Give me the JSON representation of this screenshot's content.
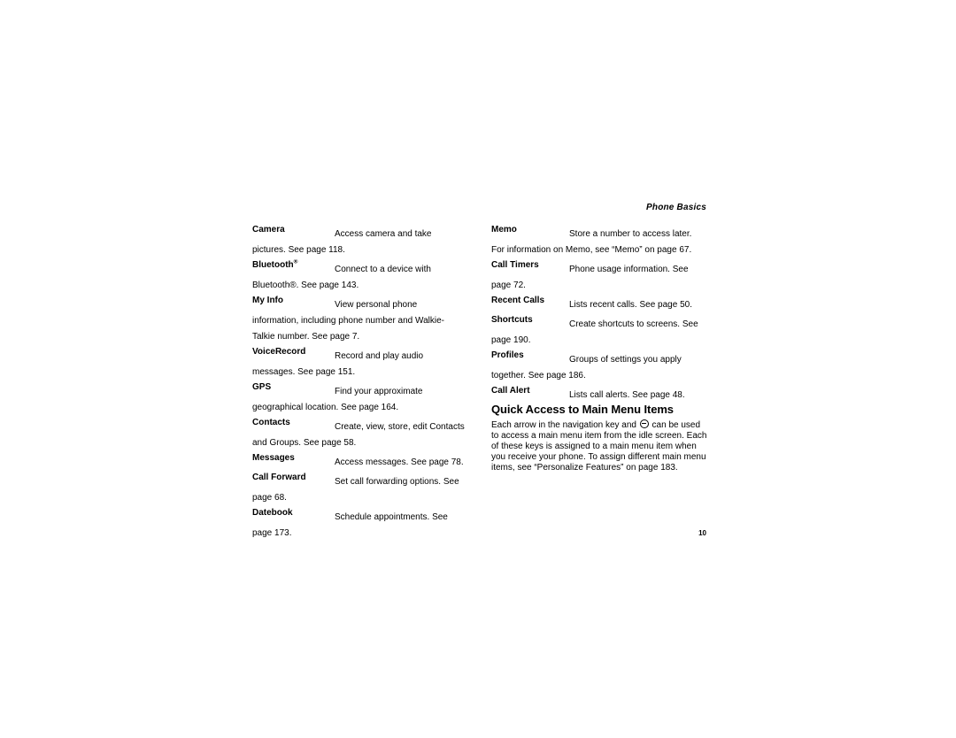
{
  "document": {
    "running_head": "Phone Basics",
    "page_number": "10"
  },
  "left_column": {
    "entries": [
      {
        "term": "Camera",
        "term_suffix": "",
        "description": "Access camera and take pictures. See page 118."
      },
      {
        "term": "Bluetooth",
        "term_suffix": "®",
        "description": "Connect to a device with Bluetooth®. See page 143."
      },
      {
        "term": "My Info",
        "term_suffix": "",
        "description": "View personal phone information, including phone number and Walkie-Talkie number. See page 7."
      },
      {
        "term": "VoiceRecord",
        "term_suffix": "",
        "description": "Record and play audio messages. See page 151."
      },
      {
        "term": "GPS",
        "term_suffix": "",
        "description": "Find your approximate geographical location. See page 164."
      },
      {
        "term": "Contacts",
        "term_suffix": "",
        "description": "Create, view, store, edit Contacts and Groups. See page 58."
      },
      {
        "term": "Messages",
        "term_suffix": "",
        "description": "Access messages. See page 78."
      },
      {
        "term": "Call Forward",
        "term_suffix": "",
        "description": "Set call forwarding options. See page 68."
      },
      {
        "term": "Datebook",
        "term_suffix": "",
        "description": "Schedule appointments. See page 173."
      }
    ]
  },
  "right_column": {
    "entries": [
      {
        "term": "Memo",
        "description": "Store a number to access later. For information on Memo, see “Memo” on page 67."
      },
      {
        "term": "Call Timers",
        "description": "Phone usage information. See page 72."
      },
      {
        "term": "Recent Calls",
        "description": "Lists recent calls. See page 50."
      },
      {
        "term": "Shortcuts",
        "description": "Create shortcuts to screens. See page 190."
      },
      {
        "term": "Profiles",
        "description": "Groups of settings you apply together. See page 186."
      },
      {
        "term": "Call Alert",
        "description": "Lists call alerts. See page 48."
      }
    ]
  },
  "section": {
    "heading": "Quick Access to Main Menu Items",
    "body_before_icon": "Each arrow in the navigation key and ",
    "icon_name": "menu-key-icon",
    "body_after_icon": " can be used to access a main menu item from the idle screen. Each of these keys is assigned to a main menu item when you receive your phone. To assign different main menu items, see “Personalize Features” on page 183."
  }
}
